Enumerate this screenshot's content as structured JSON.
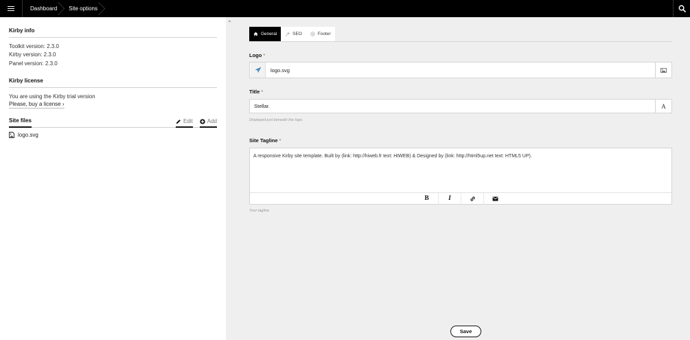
{
  "topbar": {
    "breadcrumbs": [
      "Dashboard",
      "Site options"
    ],
    "menu_icon": "hamburger-menu-icon",
    "search_icon": "search-icon",
    "background": "#000000"
  },
  "sidebar": {
    "kirby_info": {
      "heading": "Kirby info",
      "lines": [
        "Toolkit version: 2.3.0",
        "Kirby version: 2.3.0",
        "Panel version: 2.3.0"
      ]
    },
    "kirby_license": {
      "heading": "Kirby license",
      "text": "You are using the Kirby trial version",
      "link": "Please, buy a license ›"
    },
    "site_files": {
      "heading": "Site files",
      "edit_label": "Edit",
      "add_label": "Add",
      "files": [
        {
          "name": "logo.svg",
          "icon": "file-image-icon"
        }
      ]
    }
  },
  "main": {
    "tabs": [
      {
        "label": "General",
        "icon": "home-icon",
        "active": true
      },
      {
        "label": "SEO",
        "icon": "wrench-icon",
        "active": false
      },
      {
        "label": "Footer",
        "icon": "circle-icon",
        "active": false
      }
    ],
    "fields": {
      "logo": {
        "label": "Logo",
        "required": "*",
        "value": "logo.svg",
        "addon_icon": "image-icon"
      },
      "title": {
        "label": "Title",
        "required": "*",
        "value": "Stellar.",
        "addon_icon": "font-icon",
        "addon_text": "A",
        "help": "Displayed just beneath the logo."
      },
      "tagline": {
        "label": "Site Tagline",
        "required": "*",
        "value": "A responsive Kirby site template. Built by (link: http://hiweb.fr text: HIWEB) & Designed by (link: http://html5up.net text: HTML5 UP).",
        "help": "Your tagline",
        "toolbar": [
          {
            "name": "bold",
            "label": "B"
          },
          {
            "name": "italic",
            "label": "I"
          },
          {
            "name": "link",
            "icon": "link-icon"
          },
          {
            "name": "email",
            "icon": "envelope-icon"
          }
        ]
      }
    },
    "save_label": "Save"
  }
}
